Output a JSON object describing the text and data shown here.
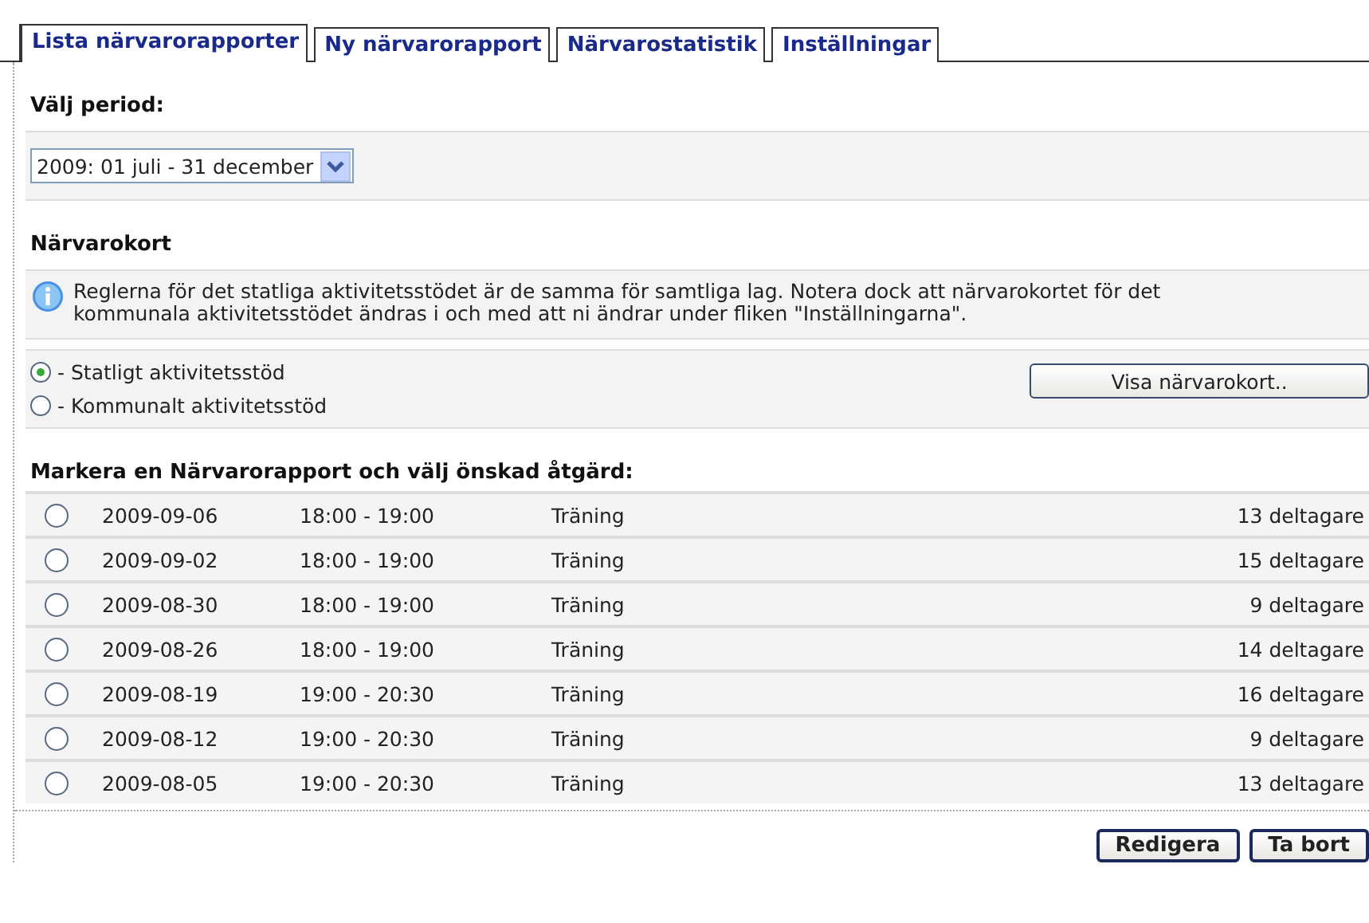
{
  "tabs": [
    {
      "label": "Lista närvarorapporter",
      "selected": true
    },
    {
      "label": "Ny närvarorapport",
      "selected": false
    },
    {
      "label": "Närvarostatistik",
      "selected": false
    },
    {
      "label": "Inställningar",
      "selected": false
    }
  ],
  "period": {
    "heading": "Välj period:",
    "value": "2009: 01 juli - 31 december"
  },
  "card": {
    "heading": "Närvarokort",
    "info": "Reglerna för det statliga aktivitetsstödet är de samma för samtliga lag. Notera dock att närvarokortet för det kommunala aktivitetsstödet ändras i och med att ni ändrar under fliken \"Inställningarna\".",
    "options": [
      {
        "label": "- Statligt aktivitetsstöd",
        "selected": true
      },
      {
        "label": "- Kommunalt aktivitetsstöd",
        "selected": false
      }
    ],
    "button": "Visa närvarokort.."
  },
  "reports": {
    "heading": "Markera en Närvarorapport och välj önskad åtgärd:",
    "rows": [
      {
        "date": "2009-09-06",
        "time": "18:00 - 19:00",
        "type": "Träning",
        "participants": "13 deltagare",
        "selected": false
      },
      {
        "date": "2009-09-02",
        "time": "18:00 - 19:00",
        "type": "Träning",
        "participants": "15 deltagare",
        "selected": false
      },
      {
        "date": "2009-08-30",
        "time": "18:00 - 19:00",
        "type": "Träning",
        "participants": "9 deltagare",
        "selected": false
      },
      {
        "date": "2009-08-26",
        "time": "18:00 - 19:00",
        "type": "Träning",
        "participants": "14 deltagare",
        "selected": false
      },
      {
        "date": "2009-08-19",
        "time": "19:00 - 20:30",
        "type": "Träning",
        "participants": "16 deltagare",
        "selected": false
      },
      {
        "date": "2009-08-12",
        "time": "19:00 - 20:30",
        "type": "Träning",
        "participants": "9 deltagare",
        "selected": false
      },
      {
        "date": "2009-08-05",
        "time": "19:00 - 20:30",
        "type": "Träning",
        "participants": "13 deltagare",
        "selected": false
      }
    ]
  },
  "buttons": [
    "Redigera",
    "Ta bort"
  ]
}
